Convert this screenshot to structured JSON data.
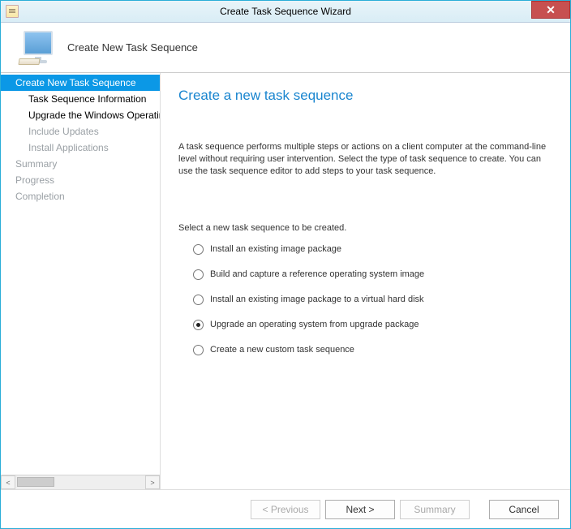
{
  "window": {
    "title": "Create Task Sequence Wizard"
  },
  "header": {
    "subtitle": "Create New Task Sequence"
  },
  "sidebar": {
    "items": [
      {
        "label": "Create New Task Sequence",
        "level": 1,
        "state": "active"
      },
      {
        "label": "Task Sequence Information",
        "level": 2,
        "state": "bold"
      },
      {
        "label": "Upgrade the Windows Operating System",
        "level": 2,
        "state": "bold"
      },
      {
        "label": "Include Updates",
        "level": 2,
        "state": "faded"
      },
      {
        "label": "Install Applications",
        "level": 2,
        "state": "faded"
      },
      {
        "label": "Summary",
        "level": 1,
        "state": "faded"
      },
      {
        "label": "Progress",
        "level": 1,
        "state": "faded"
      },
      {
        "label": "Completion",
        "level": 1,
        "state": "faded"
      }
    ]
  },
  "main": {
    "heading": "Create a new task sequence",
    "description": "A task sequence performs multiple steps or actions on a client computer at the command-line level without requiring user intervention. Select the type of task sequence to create. You can use the task sequence editor to add steps to your task sequence.",
    "prompt": "Select a new task sequence to be created.",
    "options": [
      {
        "label": "Install an existing image package",
        "checked": false
      },
      {
        "label": "Build and capture a reference operating system image",
        "checked": false
      },
      {
        "label": "Install an existing image package to a virtual hard disk",
        "checked": false
      },
      {
        "label": "Upgrade an operating system from upgrade package",
        "checked": true
      },
      {
        "label": "Create a new custom task sequence",
        "checked": false
      }
    ]
  },
  "footer": {
    "previous": "< Previous",
    "next": "Next >",
    "summary": "Summary",
    "cancel": "Cancel"
  }
}
